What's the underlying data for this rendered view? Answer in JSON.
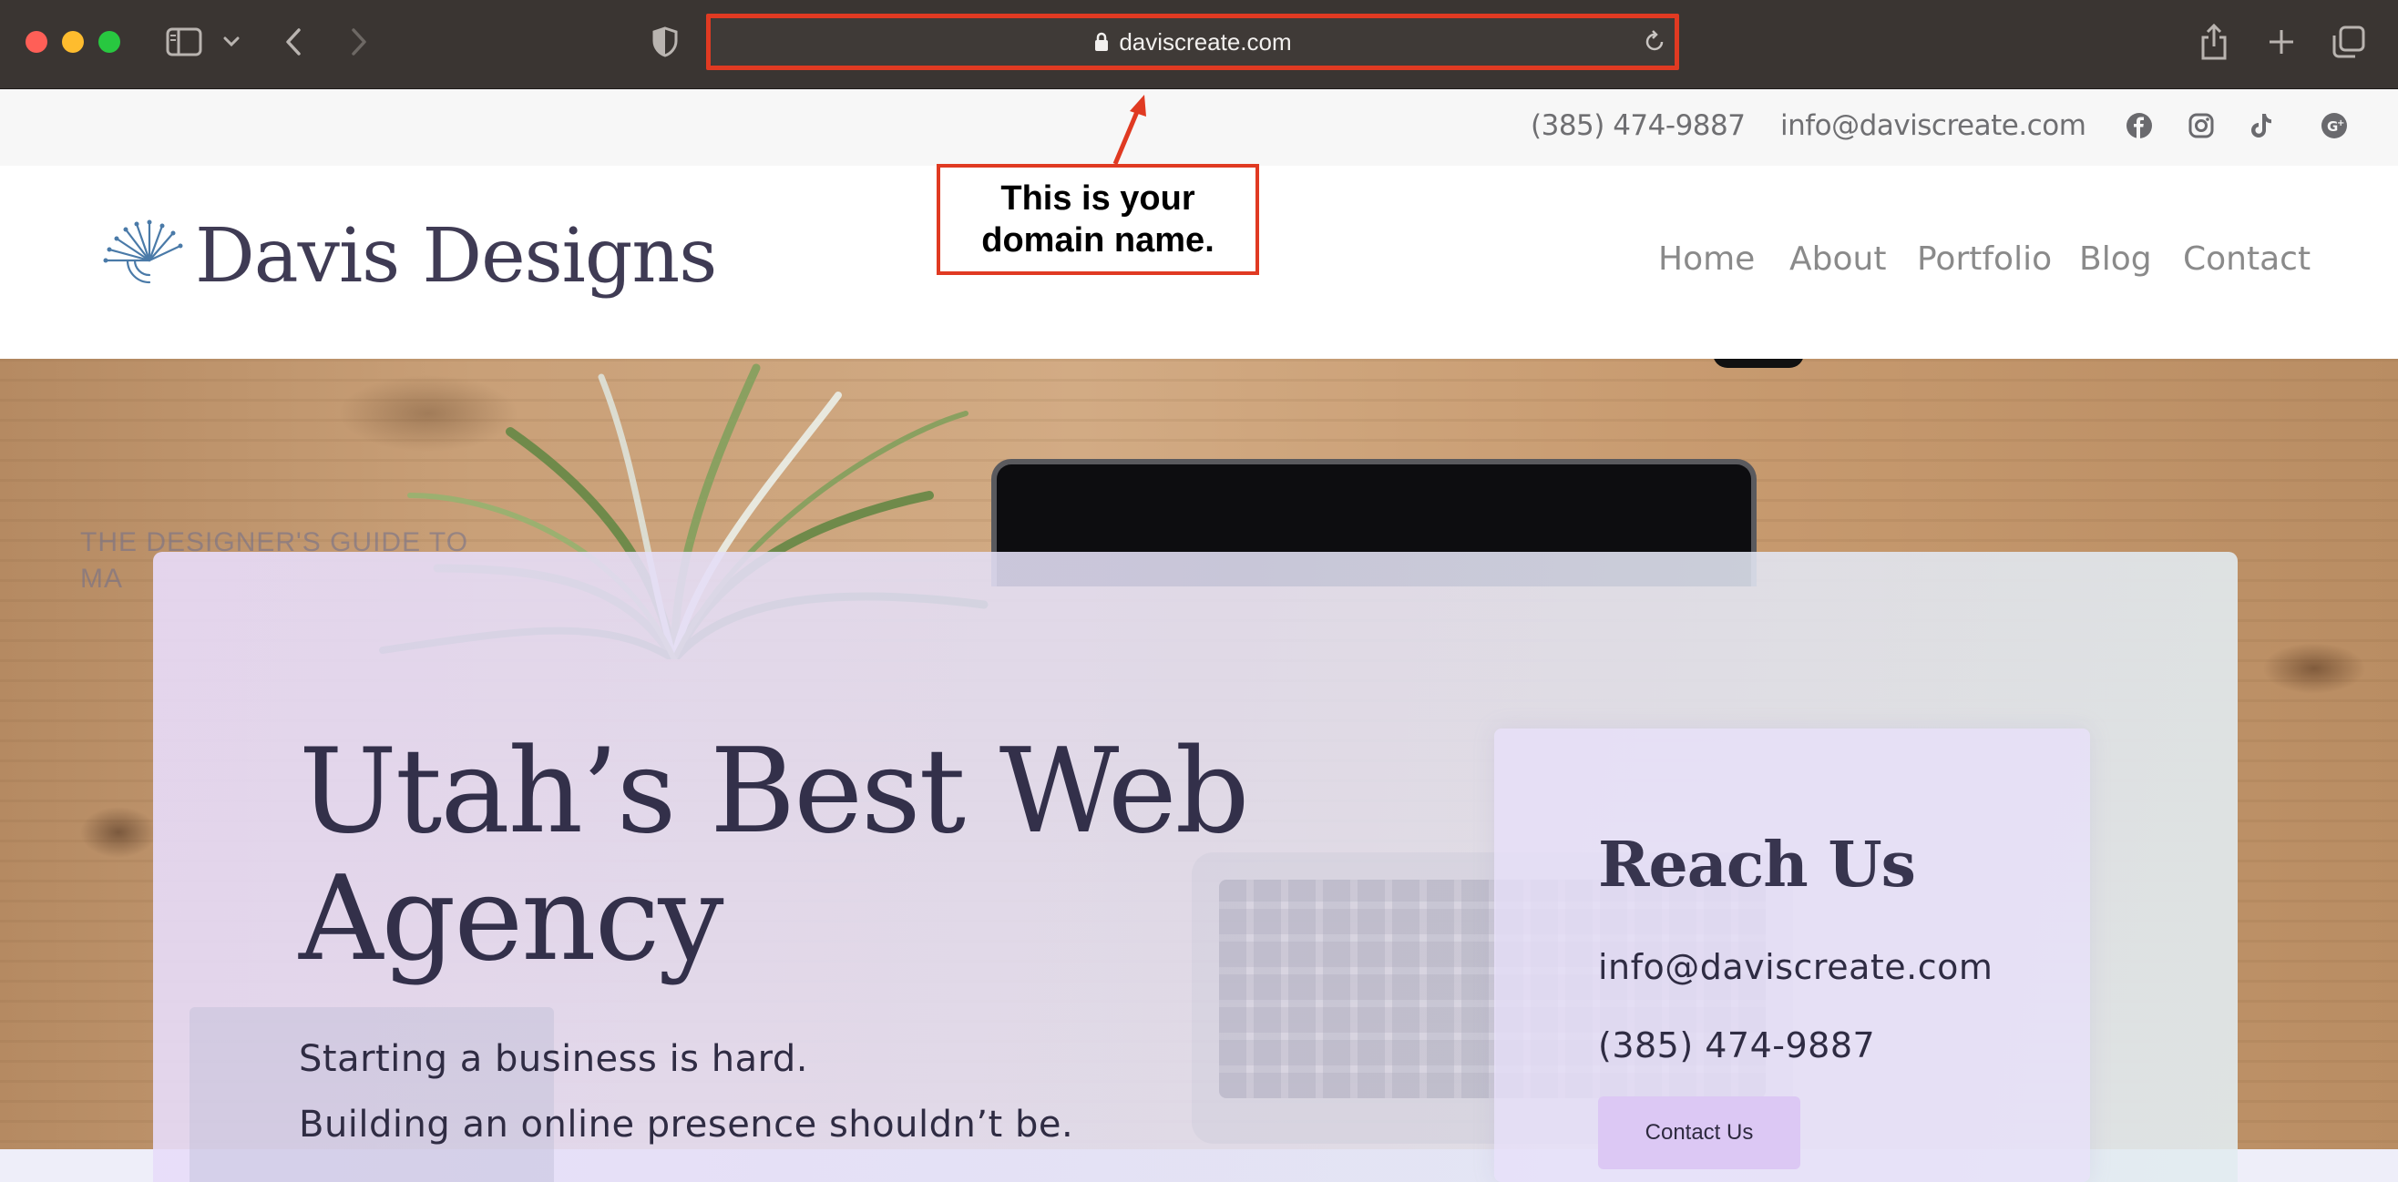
{
  "browser": {
    "url": "daviscreate.com",
    "icons": [
      "sidebar-icon",
      "chevron-down-icon",
      "back-icon",
      "forward-icon",
      "shield-icon",
      "lock-icon",
      "reload-icon",
      "share-icon",
      "plus-icon",
      "tabs-icon"
    ]
  },
  "annotation": {
    "text": "This is your\ndomain name.",
    "color": "#e03a22"
  },
  "topbar": {
    "phone": "(385) 474-9887",
    "email": "info@daviscreate.com",
    "social_icons": [
      "facebook-icon",
      "instagram-icon",
      "tiktok-icon",
      "google-plus-icon"
    ]
  },
  "header": {
    "logo_text": "Davis Designs",
    "nav": [
      "Home",
      "About",
      "Portfolio",
      "Blog",
      "Contact"
    ]
  },
  "hero": {
    "title": "Utah’s Best Web\nAgency",
    "subtitle_line1": "Starting a business is hard.",
    "subtitle_line2": "Building an online presence shouldn’t be.",
    "background_book_text": "THE DESIGNER'S GUIDE TO\nMA"
  },
  "reach": {
    "title": "Reach Us",
    "email": "info@daviscreate.com",
    "phone": "(385) 474-9887",
    "button": "Contact Us"
  },
  "colors": {
    "accent_red": "#e03a22",
    "brand_text": "#3f3b54",
    "button_bg": "#dcc8f4"
  }
}
